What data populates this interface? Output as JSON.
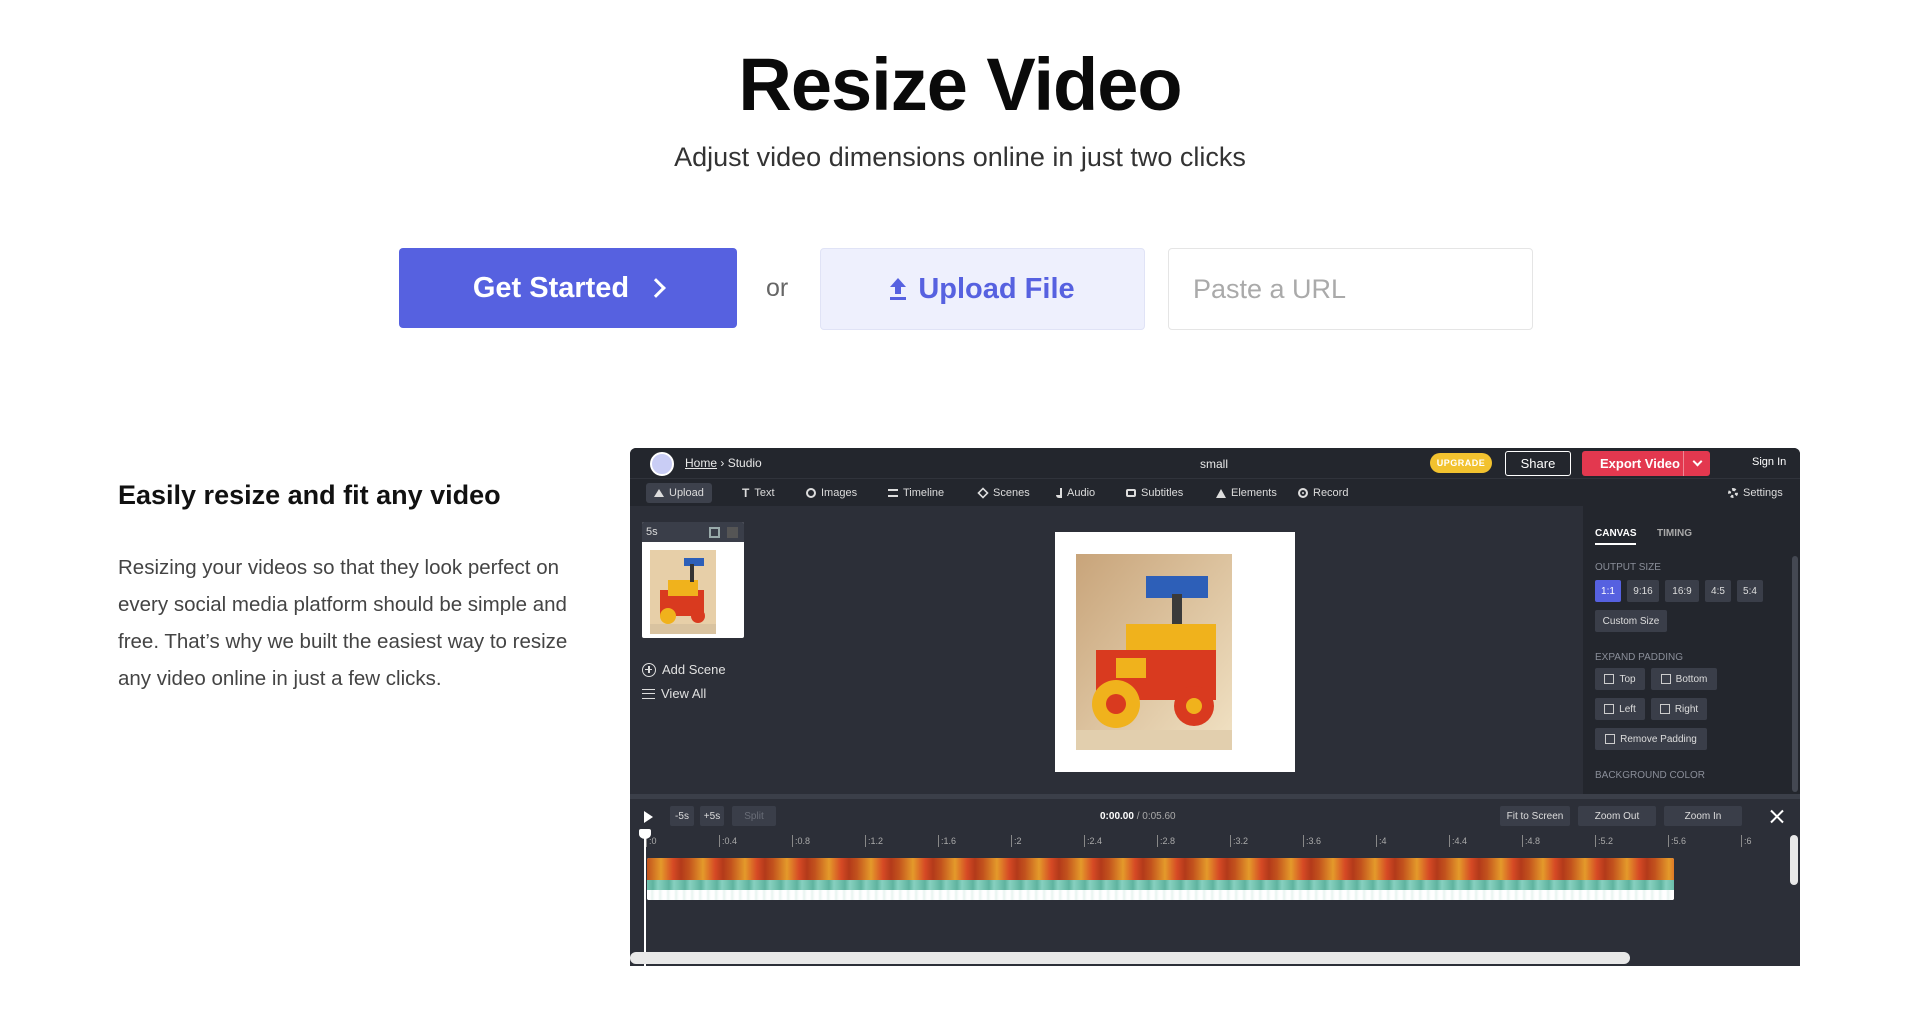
{
  "hero": {
    "title": "Resize Video",
    "subtitle": "Adjust video dimensions online in just two clicks"
  },
  "cta": {
    "get_started_label": "Get Started",
    "or_label": "or",
    "upload_label": "Upload File",
    "url_placeholder": "Paste a URL"
  },
  "feature": {
    "heading": "Easily resize and fit any video",
    "body": "Resizing your videos so that they look perfect on every social media platform should be simple and free. That’s why we built the easiest way to resize any video online in just a few clicks."
  },
  "studio": {
    "breadcrumb_home": "Home",
    "breadcrumb_sep": "›",
    "breadcrumb_current": "Studio",
    "project_name": "small",
    "upgrade_label": "UPGRADE",
    "share_label": "Share",
    "export_label": "Export Video",
    "signin_label": "Sign In",
    "toolbar": {
      "upload": "Upload",
      "text": "Text",
      "images": "Images",
      "timeline": "Timeline",
      "scenes": "Scenes",
      "audio": "Audio",
      "subtitles": "Subtitles",
      "elements": "Elements",
      "record": "Record",
      "settings": "Settings"
    },
    "scene_duration": "5s",
    "add_scene_label": "Add Scene",
    "view_all_label": "View All",
    "panel": {
      "tab_canvas": "CANVAS",
      "tab_timing": "TIMING",
      "output_size_label": "OUTPUT SIZE",
      "ratios": [
        "1:1",
        "9:16",
        "16:9",
        "4:5",
        "5:4"
      ],
      "custom_size_label": "Custom Size",
      "expand_padding_label": "EXPAND PADDING",
      "pad_top": "Top",
      "pad_bottom": "Bottom",
      "pad_left": "Left",
      "pad_right": "Right",
      "remove_padding": "Remove Padding",
      "background_color_label": "BACKGROUND COLOR"
    },
    "timeline": {
      "minus5": "-5s",
      "plus5": "+5s",
      "split": "Split",
      "current_time": "0:00.00",
      "duration": " / 0:05.60",
      "fit_to_screen": "Fit to Screen",
      "zoom_out": "Zoom Out",
      "zoom_in": "Zoom In",
      "ticks": [
        ":0",
        ":0.4",
        ":0.8",
        ":1.2",
        ":1.6",
        ":2",
        ":2.4",
        ":2.8",
        ":3.2",
        ":3.6",
        ":4",
        ":4.4",
        ":4.8",
        ":5.2",
        ":5.6",
        ":6"
      ]
    }
  },
  "colors": {
    "accent": "#5661e0",
    "export": "#e3384f",
    "upgrade": "#f2c22f",
    "studio_bg": "#2c2f38"
  }
}
